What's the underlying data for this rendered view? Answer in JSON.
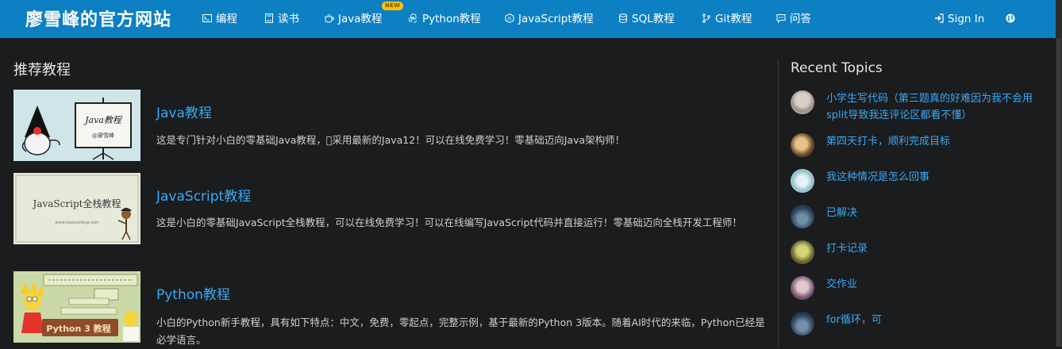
{
  "header": {
    "brand": "廖雪峰的官方网站",
    "nav": [
      {
        "label": "编程",
        "icon": "terminal-icon"
      },
      {
        "label": "读书",
        "icon": "book-icon"
      },
      {
        "label": "Java教程",
        "icon": "coffee-icon"
      },
      {
        "label": "Python教程",
        "icon": "python-icon"
      },
      {
        "label": "JavaScript教程",
        "icon": "javascript-icon"
      },
      {
        "label": "SQL教程",
        "icon": "database-icon"
      },
      {
        "label": "Git教程",
        "icon": "git-branch-icon"
      },
      {
        "label": "问答",
        "icon": "chat-icon"
      }
    ],
    "new_badge": "NEW",
    "sign_in": "Sign In",
    "accent_color": "#0d80c4",
    "badge_color": "#ffc107"
  },
  "main": {
    "section_title": "推荐教程",
    "courses": [
      {
        "title": "Java教程",
        "description": "这是专门针对小白的零基础Java教程，\u0000采用最新的Java12！可以在线免费学习！零基础迈向Java架构师！",
        "thumb_text": [
          "Java教程",
          "@廖雪峰"
        ]
      },
      {
        "title": "JavaScript教程",
        "description": "这是小白的零基础JavaScript全栈教程，可以在线免费学习！可以在线编写JavaScript代码并直接运行！零基础迈向全栈开发工程师！",
        "thumb_text": [
          "JavaScript全栈教程",
          "www.liaoxuefeng.com"
        ]
      },
      {
        "title": "Python教程",
        "description": "小白的Python新手教程，具有如下特点：中文，免费，零起点，完整示例，基于最新的Python 3版本。随着AI时代的来临，Python已经是必学语言。",
        "thumb_text": [
          "Python 3 教程"
        ]
      }
    ],
    "link_color": "#39a9f5"
  },
  "sidebar": {
    "title": "Recent Topics",
    "topics": [
      {
        "text": "小学生写代码（第三题真的好难因为我不会用split导致我连评论区都看不懂）"
      },
      {
        "text": "第四天打卡，顺利完成目标"
      },
      {
        "text": "我这种情况是怎么回事"
      },
      {
        "text": "已解决"
      },
      {
        "text": "打卡记录"
      },
      {
        "text": "交作业"
      },
      {
        "text": "for循环，可"
      }
    ]
  }
}
